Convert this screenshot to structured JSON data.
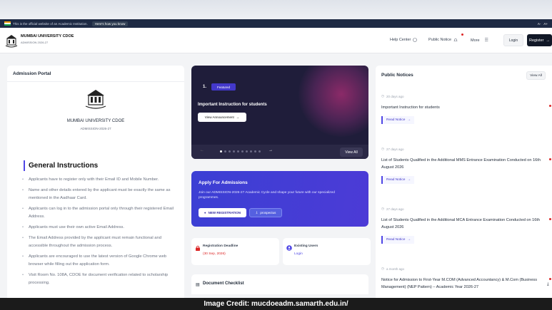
{
  "gov_bar": {
    "text": "This is the official website of an Academic Institution.",
    "here_link": "Here's how you know",
    "font_small": "A-",
    "font_large": "A+"
  },
  "header": {
    "org_name": "MUMBAI UNIVERSITY CDOE",
    "org_sub": "ADMISSION 2026-27",
    "nav": {
      "help": "Help Center",
      "notice": "Public Notice",
      "more": "More"
    },
    "login": "Login",
    "register": "Register"
  },
  "admission_portal": {
    "title": "Admission Portal",
    "university": "MUMBAI UNIVERSITY CDOE",
    "session": "ADMISSION-2026-27",
    "instructions_title": "General Instructions",
    "instructions": [
      "Applicants have to register only with their Email ID and Mobile Number.",
      "Name and other details entered by the applicant must be exactly the same as mentioned in the Aadhaar Card.",
      "Applicants can log in to the admission portal only through their registered Email Address.",
      "Applicants must use their own active Email Address.",
      "The Email Address provided by the applicant must remain functional and accessible throughout the admission process.",
      "Applicants are encouraged to use the latest version of Google Chrome web browser while filling out the application form.",
      "Visit Room No. 108A, CDOE for document verification related to scholarship processing."
    ]
  },
  "announcement": {
    "number": "1.",
    "badge": "Featured",
    "title": "Important Instruction for students",
    "button": "View Announcement",
    "view_all": "View All",
    "slide_count": 10,
    "active_slide": 0
  },
  "apply": {
    "title": "Apply For Admissions",
    "desc": "Join our ADMISSION-2026-27 Academic Cycle and shape your future with our specialized programmes.",
    "new_reg": "NEW REGISTRATION",
    "prospectus": "prospectus"
  },
  "deadline": {
    "label": "Registration Deadline",
    "date": "(30 Sep, 2026)"
  },
  "existing": {
    "label": "Existing Users",
    "link": "Login"
  },
  "checklist": {
    "title": "Document Checklist"
  },
  "notices": {
    "title": "Public Notices",
    "view_all": "View All",
    "read_label": "Read Notice",
    "items": [
      {
        "time": "20 days ago",
        "text": "Important Instruction for students"
      },
      {
        "time": "27 days ago",
        "text": "List of Students Qualified in the Additional MMS Entrance Examination Conducted on 16th August 2026"
      },
      {
        "time": "27 days ago",
        "text": "List of Students Qualified in the Additional MCA Entrance Examination Conducted on 16th August 2026"
      },
      {
        "time": "a month ago",
        "text": "Notice for Admission to First-Year M.COM (Advanced Accountancy) & M.Com (Business Management) (NEP Pattern) – Academic Year 2026-27"
      }
    ]
  },
  "credit": "Image Credit: mucdoeadm.samarth.edu.in/",
  "colors": {
    "accent": "#4f46e5",
    "deadline": "#dc2626",
    "dark": "#111827"
  }
}
